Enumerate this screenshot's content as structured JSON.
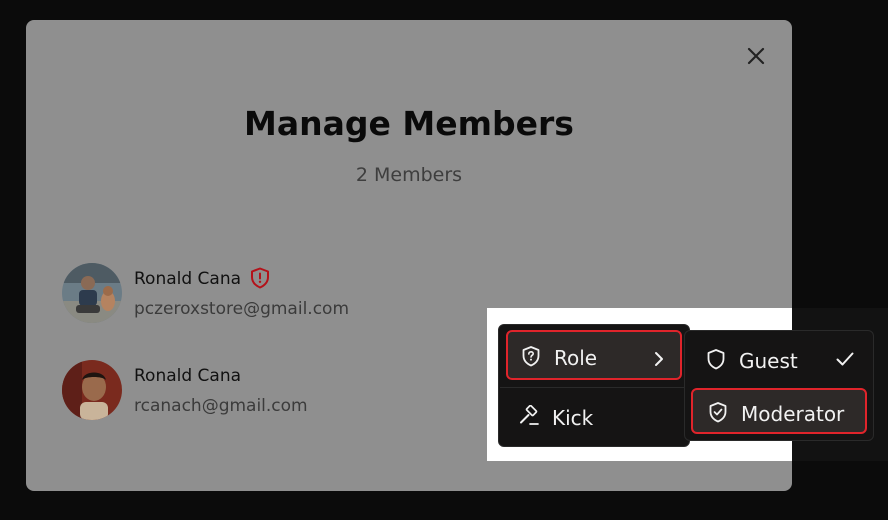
{
  "modal": {
    "title": "Manage Members",
    "subtitle": "2 Members"
  },
  "members": [
    {
      "name": "Ronald Cana",
      "email": "pczeroxstore@gmail.com",
      "role_icon": "shield-alert-icon"
    },
    {
      "name": "Ronald Cana",
      "email": "rcanach@gmail.com"
    }
  ],
  "menu": {
    "items": [
      {
        "label": "Role",
        "icon": "shield-question-icon"
      },
      {
        "label": "Kick",
        "icon": "gavel-icon"
      }
    ]
  },
  "role_submenu": {
    "items": [
      {
        "label": "Guest",
        "icon": "shield-icon",
        "checked": true
      },
      {
        "label": "Moderator",
        "icon": "shield-check-icon"
      }
    ]
  },
  "colors": {
    "accent_red": "#e0242b",
    "modal_bg": "#8f8f8f",
    "menu_bg": "#151414"
  }
}
